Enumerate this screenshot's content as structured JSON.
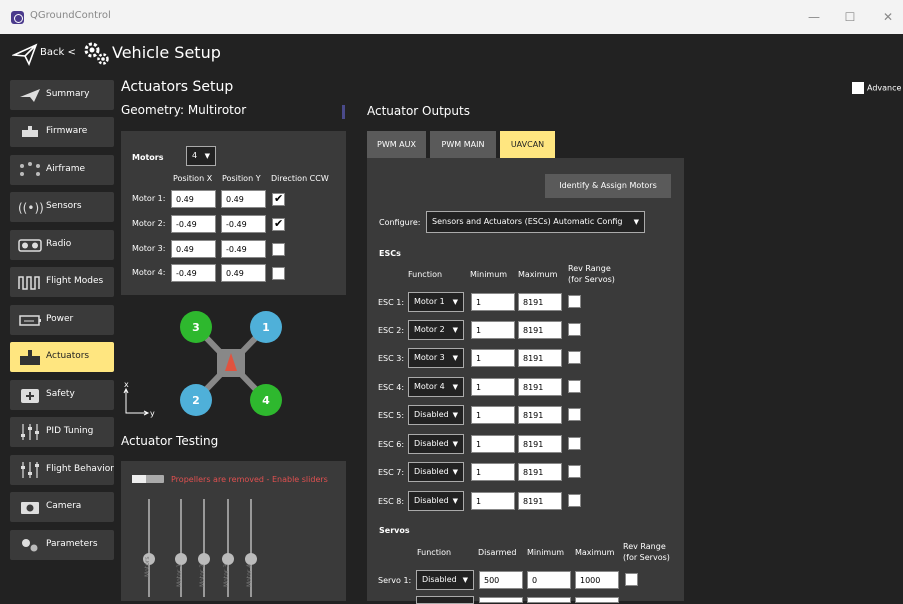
{
  "window": {
    "app_title": "QGroundControl",
    "minimize": "—",
    "maximize": "☐",
    "close": "✕"
  },
  "toolbar": {
    "back_label": "Back <",
    "page_title": "Vehicle Setup"
  },
  "sidebar": {
    "items": [
      {
        "label": "Summary",
        "icon": "plane-icon"
      },
      {
        "label": "Firmware",
        "icon": "firmware-icon"
      },
      {
        "label": "Airframe",
        "icon": "airframe-icon"
      },
      {
        "label": "Sensors",
        "icon": "sensors-icon"
      },
      {
        "label": "Radio",
        "icon": "radio-icon"
      },
      {
        "label": "Flight Modes",
        "icon": "flight-modes-icon"
      },
      {
        "label": "Power",
        "icon": "power-icon"
      },
      {
        "label": "Actuators",
        "icon": "actuators-icon",
        "active": true
      },
      {
        "label": "Safety",
        "icon": "safety-icon"
      },
      {
        "label": "PID Tuning",
        "icon": "pid-tuning-icon"
      },
      {
        "label": "Flight Behavior",
        "icon": "flight-behavior-icon"
      },
      {
        "label": "Camera",
        "icon": "camera-icon"
      },
      {
        "label": "Parameters",
        "icon": "parameters-icon"
      }
    ]
  },
  "setup": {
    "title": "Actuators Setup",
    "geometry_title": "Geometry: Multirotor",
    "advanced_label": "Advance"
  },
  "geometry": {
    "motors_label": "Motors",
    "motors_count": "4",
    "col_position_x": "Position X",
    "col_position_y": "Position Y",
    "col_direction": "Direction CCW",
    "motors": [
      {
        "label": "Motor 1:",
        "x": "0.49",
        "y": "0.49",
        "ccw": true
      },
      {
        "label": "Motor 2:",
        "x": "-0.49",
        "y": "-0.49",
        "ccw": true
      },
      {
        "label": "Motor 3:",
        "x": "0.49",
        "y": "-0.49",
        "ccw": false
      },
      {
        "label": "Motor 4:",
        "x": "-0.49",
        "y": "0.49",
        "ccw": false
      }
    ],
    "diagram_numbers": [
      "3",
      "1",
      "2",
      "4"
    ],
    "axis_x": "x",
    "axis_y": "y",
    "colors": {
      "green": "#2eb82e",
      "blue": "#4fb0d9",
      "frame": "#888888",
      "arrow": "#e0533f"
    }
  },
  "testing": {
    "title": "Actuator Testing",
    "enable_label": "Propellers are removed - Enable sliders",
    "warning_color": "#e05050",
    "slider_labels": [
      "Motors",
      "Motor 1",
      "Motor 2",
      "Motor 3",
      "Motor 4"
    ]
  },
  "outputs": {
    "title": "Actuator Outputs",
    "tabs": [
      "PWM AUX",
      "PWM MAIN",
      "UAVCAN"
    ],
    "active_tab": "UAVCAN",
    "identify_button": "Identify & Assign Motors",
    "configure_label": "Configure:",
    "configure_value": "Sensors and Actuators (ESCs) Automatic Config",
    "escs_title": "ESCs",
    "esc_headers": {
      "function": "Function",
      "minimum": "Minimum",
      "maximum": "Maximum",
      "rev_range_1": "Rev Range",
      "rev_range_2": "(for Servos)"
    },
    "escs": [
      {
        "label": "ESC 1:",
        "function": "Motor 1",
        "min": "1",
        "max": "8191"
      },
      {
        "label": "ESC 2:",
        "function": "Motor 2",
        "min": "1",
        "max": "8191"
      },
      {
        "label": "ESC 3:",
        "function": "Motor 3",
        "min": "1",
        "max": "8191"
      },
      {
        "label": "ESC 4:",
        "function": "Motor 4",
        "min": "1",
        "max": "8191"
      },
      {
        "label": "ESC 5:",
        "function": "Disabled",
        "min": "1",
        "max": "8191"
      },
      {
        "label": "ESC 6:",
        "function": "Disabled",
        "min": "1",
        "max": "8191"
      },
      {
        "label": "ESC 7:",
        "function": "Disabled",
        "min": "1",
        "max": "8191"
      },
      {
        "label": "ESC 8:",
        "function": "Disabled",
        "min": "1",
        "max": "8191"
      }
    ],
    "servos_title": "Servos",
    "servo_headers": {
      "function": "Function",
      "disarmed": "Disarmed",
      "minimum": "Minimum",
      "maximum": "Maximum",
      "rev_range_1": "Rev Range",
      "rev_range_2": "(for Servos)"
    },
    "servos": [
      {
        "label": "Servo 1:",
        "function": "Disabled",
        "disarmed": "500",
        "min": "0",
        "max": "1000"
      }
    ]
  },
  "theme": {
    "accent": "#ffe680",
    "panel": "#3a3a3a",
    "background": "#222222"
  }
}
